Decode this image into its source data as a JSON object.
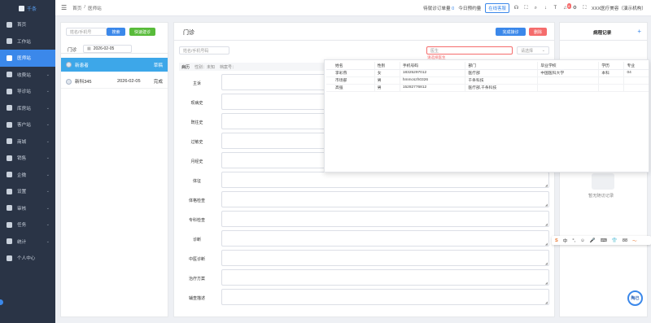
{
  "app": {
    "logo_text": "千条"
  },
  "sidebar": {
    "items": [
      {
        "label": "首页",
        "chevron": ""
      },
      {
        "label": "工作站",
        "chevron": ""
      },
      {
        "label": "医师站",
        "chevron": ""
      },
      {
        "label": "收费站",
        "chevron": "⌄"
      },
      {
        "label": "导诊站",
        "chevron": "⌄"
      },
      {
        "label": "库房站",
        "chevron": "⌄"
      },
      {
        "label": "客户站",
        "chevron": "⌄"
      },
      {
        "label": "商城",
        "chevron": "⌄"
      },
      {
        "label": "销售",
        "chevron": "⌄"
      },
      {
        "label": "企微",
        "chevron": "⌄"
      },
      {
        "label": "设置",
        "chevron": "⌄"
      },
      {
        "label": "审核",
        "chevron": "⌄"
      },
      {
        "label": "任务",
        "chevron": "⌄"
      },
      {
        "label": "统计",
        "chevron": "⌄"
      },
      {
        "label": "个人中心",
        "chevron": ""
      }
    ],
    "active_index": 2
  },
  "topbar": {
    "breadcrumb": [
      "首页",
      "/",
      "医师站"
    ],
    "pending_label": "待就诊订单量",
    "pending_count": "0",
    "today_label": "今日预约量",
    "online_button": "在线客服",
    "notification_count": "8",
    "org_name": "XXX医疗美容（演示机构）"
  },
  "left_panel": {
    "search_placeholder": "姓名/手机号",
    "search_button": "搜索",
    "quick_button": "快速建诊",
    "tab_label": "门诊",
    "date_value": "2026-02-05",
    "header": {
      "name": "新患者",
      "status": "草稿"
    },
    "rows": [
      {
        "name": "新科345",
        "date": "2026-02-05",
        "status": "完成"
      }
    ]
  },
  "center": {
    "title": "门诊",
    "complete_button": "完成接诊",
    "delete_button": "删除",
    "patient_placeholder": "姓名/手机号码",
    "doctor_placeholder": "医生",
    "doctor_error": "请选择医生",
    "select_placeholder": "请选择",
    "record_info": {
      "label": "病历",
      "gender": "性别：未知",
      "archive": "档案号："
    },
    "fields": [
      "主诉",
      "现病史",
      "既往史",
      "过敏史",
      "月经史",
      "体征",
      "体格检查",
      "专科检查",
      "诊断",
      "中医诊断",
      "治疗方案",
      "辅查描述"
    ]
  },
  "dropdown": {
    "columns": [
      "姓名",
      "性别",
      "手机号码",
      "部门",
      "毕业学校",
      "学历",
      "专业"
    ],
    "rows": [
      [
        "李彩燕",
        "女",
        "18325297012",
        "医疗部",
        "中国医科大学",
        "本科",
        "04"
      ],
      [
        "市场部",
        "男",
        "hmmcszh0326",
        "千条科技",
        "",
        "",
        ""
      ],
      [
        "高强",
        "男",
        "15282776812",
        "医疗部,千条科技",
        "",
        "",
        ""
      ]
    ]
  },
  "right_panel": {
    "title": "病程记录",
    "add": "+",
    "empty_text": "暂无随访记录"
  },
  "ime": {
    "items": [
      "S",
      "中",
      "°,",
      "☺",
      "🎤",
      "⌨",
      "👕",
      "88",
      "〜"
    ]
  },
  "float_button": "陶己"
}
